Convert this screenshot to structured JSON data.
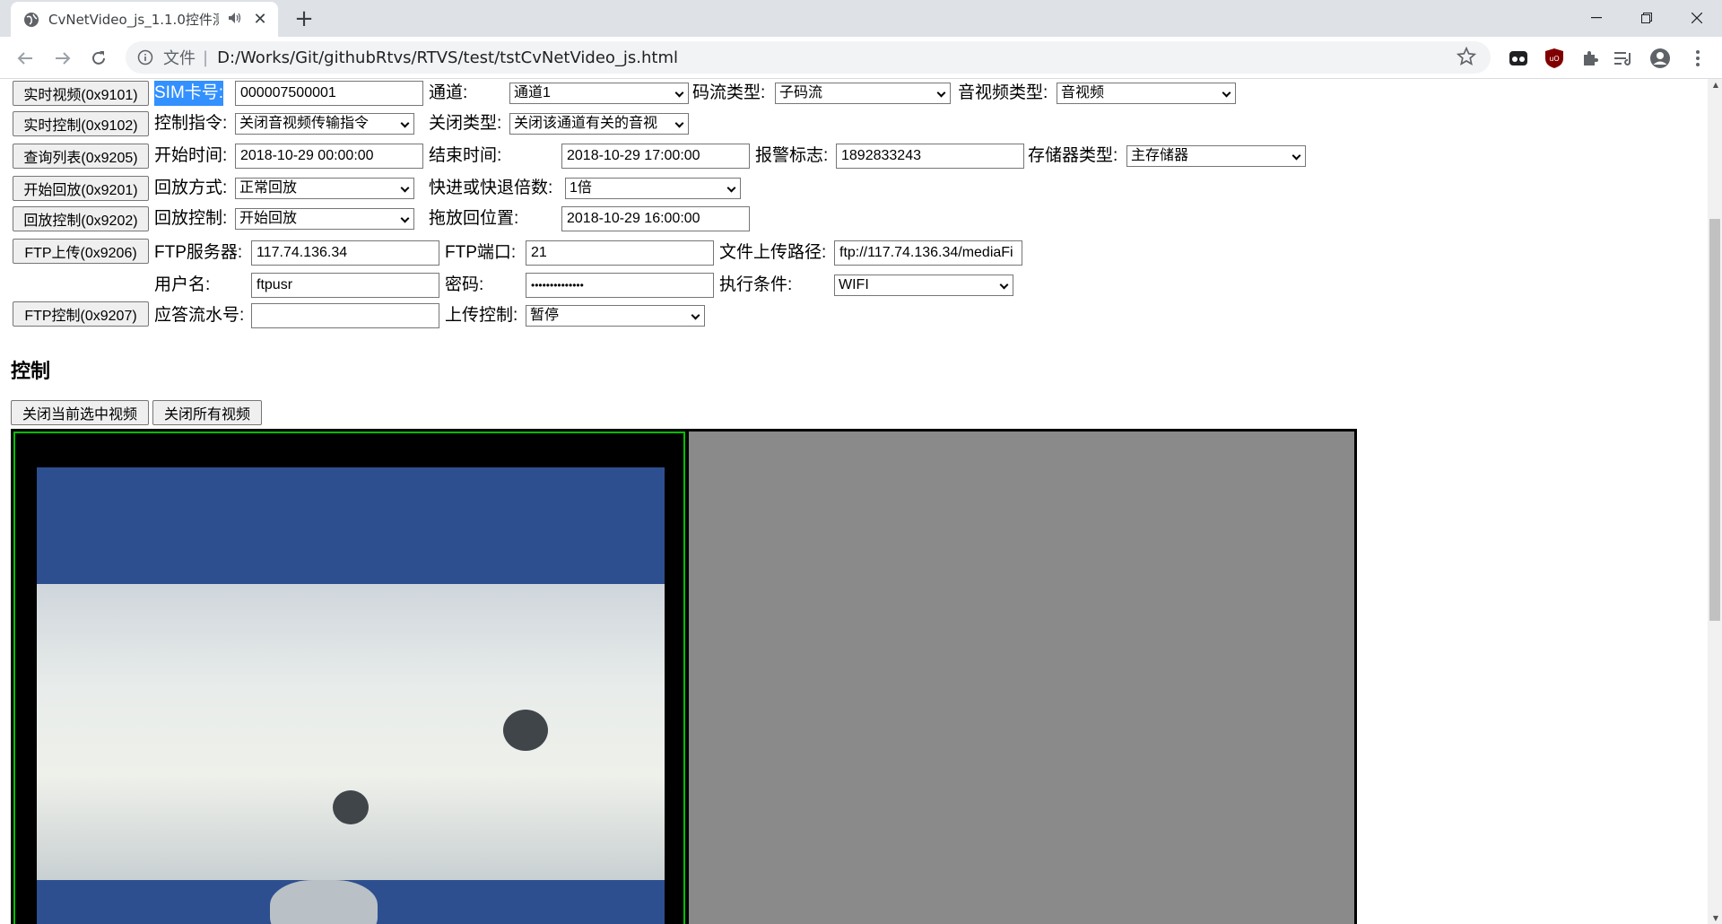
{
  "browser": {
    "tab_title": "CvNetVideo_js_1.1.0控件测",
    "tab_icons": {
      "favicon": "globe-icon",
      "audio": "speaker-icon",
      "close": "close-icon"
    },
    "new_tab_icon": "plus-icon",
    "scheme_label": "文件",
    "url": "D:/Works/Git/githubRtvs/RTVS/test/tstCvNetVideo_js.html"
  },
  "form": {
    "row1": {
      "button": "实时视频(0x9101)",
      "sim_label": "SIM卡号:",
      "sim_value": "000007500001",
      "channel_label": "通道:",
      "channel_value": "通道1",
      "stream_label": "码流类型:",
      "stream_value": "子码流",
      "av_label": "音视频类型:",
      "av_value": "音视频"
    },
    "row2": {
      "button": "实时控制(0x9102)",
      "cmd_label": "控制指令:",
      "cmd_value": "关闭音视频传输指令",
      "close_label": "关闭类型:",
      "close_value": "关闭该通道有关的音视"
    },
    "row3": {
      "button": "查询列表(0x9205)",
      "start_label": "开始时间:",
      "start_value": "2018-10-29 00:00:00",
      "end_label": "结束时间:",
      "end_value": "2018-10-29 17:00:00",
      "alarm_label": "报警标志:",
      "alarm_value": "1892833243",
      "storage_label": "存储器类型:",
      "storage_value": "主存储器"
    },
    "row4": {
      "button": "开始回放(0x9201)",
      "mode_label": "回放方式:",
      "mode_value": "正常回放",
      "speed_label": "快进或快退倍数:",
      "speed_value": "1倍"
    },
    "row5": {
      "button": "回放控制(0x9202)",
      "ctrl_label": "回放控制:",
      "ctrl_value": "开始回放",
      "seek_label": "拖放回位置:",
      "seek_value": "2018-10-29 16:00:00"
    },
    "row6": {
      "button": "FTP上传(0x9206)",
      "server_label": "FTP服务器:",
      "server_value": "117.74.136.34",
      "port_label": "FTP端口:",
      "port_value": "21",
      "path_label": "文件上传路径:",
      "path_value": "ftp://117.74.136.34/mediaFi"
    },
    "row7": {
      "user_label": "用户名:",
      "user_value": "ftpusr",
      "pwd_label": "密码:",
      "pwd_value": "••••••••••••••",
      "cond_label": "执行条件:",
      "cond_value": "WIFI"
    },
    "row8": {
      "button": "FTP控制(0x9207)",
      "serial_label": "应答流水号:",
      "serial_value": "",
      "upload_label": "上传控制:",
      "upload_value": "暂停"
    }
  },
  "control": {
    "title": "控制",
    "close_current": "关闭当前选中视频",
    "close_all": "关闭所有视频"
  }
}
